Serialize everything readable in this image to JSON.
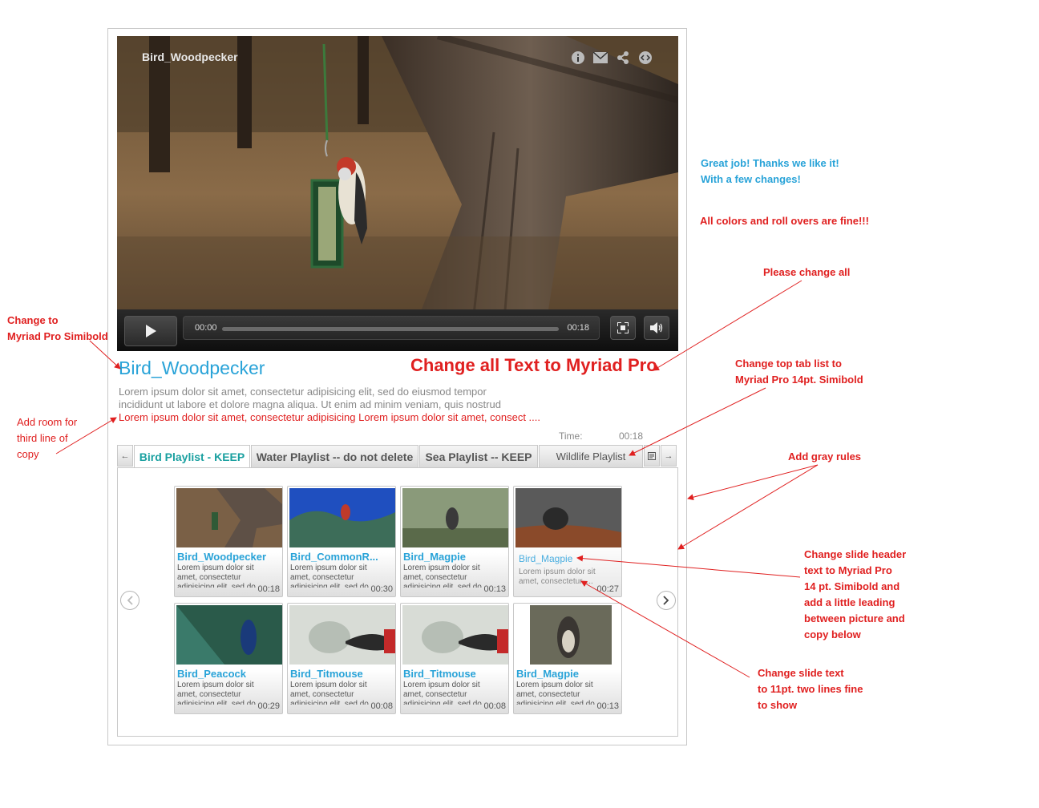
{
  "player": {
    "title": "Bird_Woodpecker",
    "current_time": "00:00",
    "duration": "00:18",
    "progress": 0,
    "icons": [
      "info-icon",
      "mail-icon",
      "share-icon",
      "embed-icon"
    ]
  },
  "video": {
    "title": "Bird_Woodpecker",
    "desc_line1": "Lorem ipsum dolor sit amet, consectetur adipisicing elit, sed do eiusmod tempor",
    "desc_line2": "incididunt ut labore et dolore magna aliqua. Ut enim ad minim veniam, quis nostrud",
    "desc_line3": "Lorem ipsum dolor sit amet, consectetur adipisicing Lorem ipsum dolor sit amet, consect ....",
    "time_label": "Time:",
    "time_value": "00:18"
  },
  "tabs": [
    {
      "label": "Bird Playlist - KEEP",
      "active": true
    },
    {
      "label": "Water Playlist -- do not delete",
      "active": false
    },
    {
      "label": "Sea Playlist -- KEEP",
      "active": false
    },
    {
      "label": "Wildlife Playlist",
      "active": false
    }
  ],
  "cards": [
    {
      "title": "Bird_Woodpecker",
      "text": "Lorem ipsum dolor sit amet, consectetur adipisicing elit, sed do",
      "duration": "00:18"
    },
    {
      "title": "Bird_CommonR...",
      "text": "Lorem ipsum dolor sit amet, consectetur adipisicing elit, sed do",
      "duration": "00:30"
    },
    {
      "title": "Bird_Magpie",
      "text": "Lorem ipsum dolor sit amet, consectetur adipisicing elit, sed do",
      "duration": "00:13"
    },
    {
      "title": "Bird_Magpie",
      "text": "Lorem ipsum dolor sit amet, consectetur.....",
      "duration": "00:27"
    },
    {
      "title": "Bird_Peacock",
      "text": "Lorem ipsum dolor sit amet, consectetur adipisicing elit, sed do",
      "duration": "00:29"
    },
    {
      "title": "Bird_Titmouse",
      "text": "Lorem ipsum dolor sit amet, consectetur adipisicing elit, sed do",
      "duration": "00:08"
    },
    {
      "title": "Bird_Titmouse",
      "text": "Lorem ipsum dolor sit amet, consectetur adipisicing elit, sed do",
      "duration": "00:08"
    },
    {
      "title": "Bird_Magpie",
      "text": "Lorem ipsum dolor sit amet, consectetur adipisicing elit, sed do",
      "duration": "00:13"
    }
  ],
  "annotations": {
    "myriad_title": [
      "Change to",
      "Myriad Pro Simibold"
    ],
    "third_line": [
      "Add room for",
      "third line of",
      "copy"
    ],
    "change_all_text": "Change all Text to Myriad Pro",
    "great_job": [
      "Great job! Thanks we like it!",
      "With a few changes!"
    ],
    "colors_fine": "All colors and roll overs are fine!!!",
    "please_change": "Please change all",
    "top_tab": [
      "Change top tab list to",
      "Myriad Pro 14pt. Simibold"
    ],
    "gray_rules": "Add gray rules",
    "slide_header": [
      "Change slide header",
      "text to Myriad Pro",
      "14 pt. Simibold  and",
      "add a little leading",
      "between picture and",
      "copy below"
    ],
    "slide_text": [
      "Change slide text",
      "to 11pt. two lines fine",
      "to show"
    ]
  },
  "colors": {
    "accent": "#29a3d8",
    "tab_active": "#1aa0a0",
    "annotation": "#e02020"
  }
}
